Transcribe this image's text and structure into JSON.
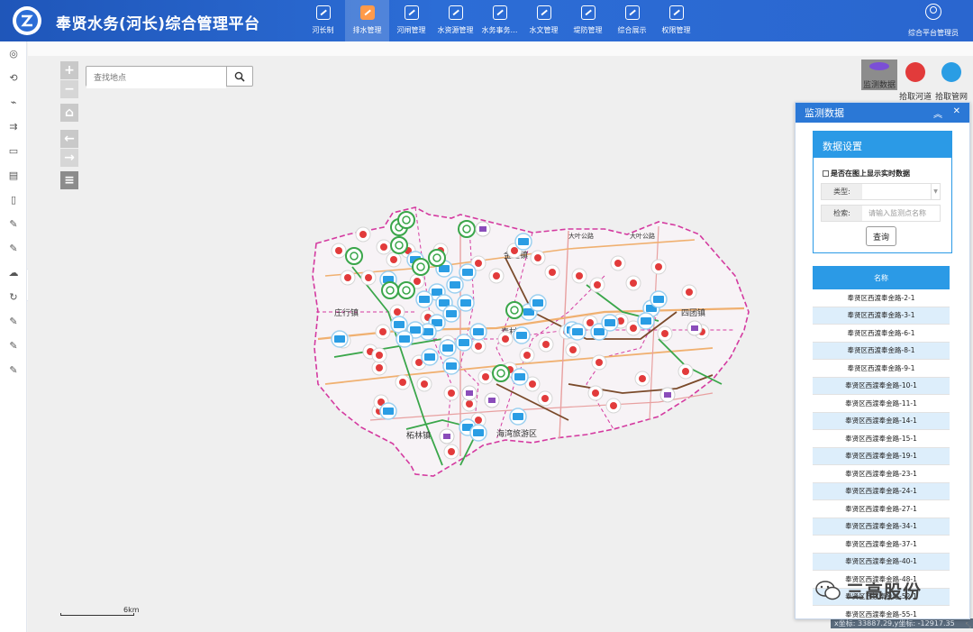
{
  "app": {
    "title": "奉贤水务(河长)综合管理平台",
    "user": "综合平台管理员"
  },
  "nav": [
    {
      "label": "河长制",
      "icon": "edit-icon"
    },
    {
      "label": "排水管理",
      "icon": "edit-icon",
      "active": true
    },
    {
      "label": "河闸管理",
      "icon": "home-icon"
    },
    {
      "label": "水资源管理",
      "icon": "chart-icon"
    },
    {
      "label": "水务事务…",
      "icon": "edit-icon"
    },
    {
      "label": "水文管理",
      "icon": "chart-icon"
    },
    {
      "label": "堤防管理",
      "icon": "edit-icon"
    },
    {
      "label": "综合展示",
      "icon": "chart-icon"
    },
    {
      "label": "权限管理",
      "icon": "chart-icon"
    }
  ],
  "sidebar": [
    "location-icon",
    "route-icon",
    "line-chart-icon",
    "flow-icon",
    "monitor-icon",
    "report-icon",
    "book-icon",
    "edit-icon",
    "edit-icon",
    "upload-icon",
    "refresh-icon",
    "edit-icon",
    "edit-icon",
    "edit-icon"
  ],
  "map": {
    "search_placeholder": "查找地点",
    "scale_label": "6km",
    "coords": "x坐标: 33887.29,y坐标: -12917.35",
    "places": [
      "金汇镇",
      "庄行镇",
      "青村镇",
      "四团镇",
      "柘林镇",
      "海湾旅游区",
      "大叶公路",
      "大叶公路"
    ]
  },
  "tools": [
    {
      "label": "监测数据",
      "color": "#7b4fd6",
      "selected": true
    },
    {
      "label": "拾取河道",
      "color": "#e23b3b"
    },
    {
      "label": "拾取管网",
      "color": "#2a9de4"
    }
  ],
  "panel": {
    "title": "监测数据",
    "settings_title": "数据设置",
    "realtime_label": "是否在图上显示实时数据",
    "type_label": "类型:",
    "type_value": "",
    "search_label": "检索:",
    "search_placeholder": "请输入监测点名称",
    "query_button": "查询",
    "column_header": "名称",
    "rows": [
      "奉贤区西渡奉金路-2-1",
      "奉贤区西渡奉金路-3-1",
      "奉贤区西渡奉金路-6-1",
      "奉贤区西渡奉金路-8-1",
      "奉贤区西渡奉金路-9-1",
      "奉贤区西渡奉金路-10-1",
      "奉贤区西渡奉金路-11-1",
      "奉贤区西渡奉金路-14-1",
      "奉贤区西渡奉金路-15-1",
      "奉贤区西渡奉金路-19-1",
      "奉贤区西渡奉金路-23-1",
      "奉贤区西渡奉金路-24-1",
      "奉贤区西渡奉金路-27-1",
      "奉贤区西渡奉金路-34-1",
      "奉贤区西渡奉金路-37-1",
      "奉贤区西渡奉金路-40-1",
      "奉贤区西渡奉金路-48-1",
      "奉贤区西渡奉金路-52-1",
      "奉贤区西渡奉金路-55-1"
    ]
  },
  "watermark": "三高股份",
  "colors": {
    "header": "#2c6dd6",
    "panel": "#2b78d6",
    "accent": "#2b9ae6",
    "pump": "#e23b3b",
    "water": "#2a9de4",
    "green": "#3aa64a"
  }
}
